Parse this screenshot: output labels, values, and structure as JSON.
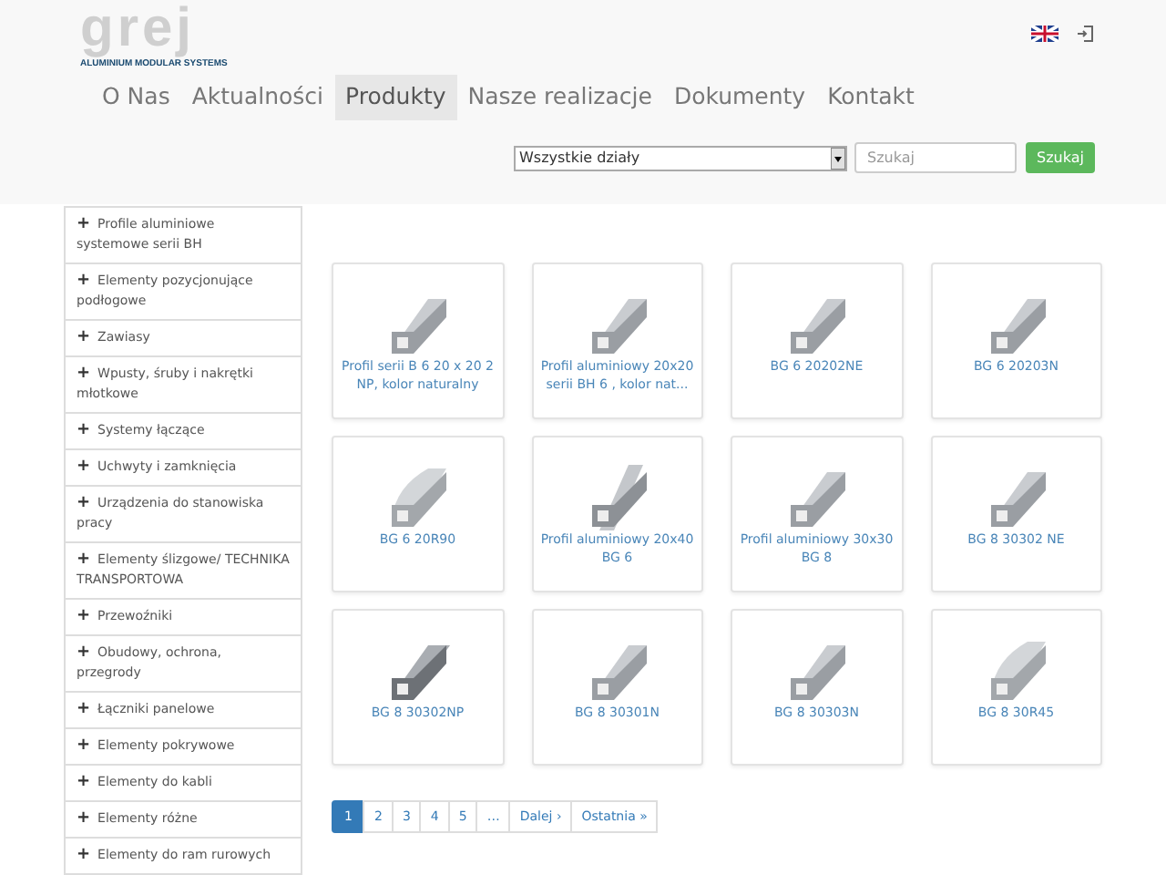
{
  "logo": {
    "name": "grej",
    "tagline": "ALUMINIUM MODULAR SYSTEMS"
  },
  "nav": [
    {
      "label": "O Nas",
      "selected": false
    },
    {
      "label": "Aktualności",
      "selected": false
    },
    {
      "label": "Produkty",
      "selected": true
    },
    {
      "label": "Nasze realizacje",
      "selected": false
    },
    {
      "label": "Dokumenty",
      "selected": false
    },
    {
      "label": "Kontakt",
      "selected": false
    }
  ],
  "search": {
    "department": "Wszystkie działy",
    "placeholder": "Szukaj",
    "button": "Szukaj"
  },
  "sidebar": {
    "icon": "+",
    "items": [
      "Profile aluminiowe systemowe serii BH",
      "Elementy pozycjonujące podłogowe",
      "Zawiasy",
      "Wpusty, śruby i nakrętki młotkowe",
      "Systemy łączące",
      "Uchwyty i zamknięcia",
      "Urządzenia do stanowiska pracy",
      "Elementy ślizgowe/ TECHNIKA TRANSPORTOWA",
      "Przewoźniki",
      "Obudowy, ochrona, przegrody",
      "Łączniki panelowe",
      "Elementy pokrywowe",
      "Elementy do kabli",
      "Elementy różne",
      "Elementy do ram rurowych"
    ]
  },
  "products": [
    {
      "name": "Profil serii B 6 20 x 20 2 NP, kolor naturalny",
      "kind": "square"
    },
    {
      "name": "Profil aluminiowy 20x20 serii BH 6 , kolor nat...",
      "kind": "square"
    },
    {
      "name": "BG 6 20202NE",
      "kind": "square"
    },
    {
      "name": "BG 6 20203N",
      "kind": "square"
    },
    {
      "name": "BG 6 20R90",
      "kind": "round"
    },
    {
      "name": "Profil aluminiowy 20x40 BG 6",
      "kind": "tall"
    },
    {
      "name": "Profil aluminiowy 30x30 BG 8",
      "kind": "square"
    },
    {
      "name": "BG 8 30302 NE",
      "kind": "square"
    },
    {
      "name": "BG 8 30302NP",
      "kind": "dark"
    },
    {
      "name": "BG 8 30301N",
      "kind": "square"
    },
    {
      "name": "BG 8 30303N",
      "kind": "square"
    },
    {
      "name": "BG 8 30R45",
      "kind": "round"
    }
  ],
  "pagination": [
    {
      "label": "1",
      "selected": true
    },
    {
      "label": "2",
      "selected": false
    },
    {
      "label": "3",
      "selected": false
    },
    {
      "label": "4",
      "selected": false
    },
    {
      "label": "5",
      "selected": false
    },
    {
      "label": "…",
      "selected": false
    },
    {
      "label": "Dalej ›",
      "selected": false
    },
    {
      "label": "Ostatnia »",
      "selected": false
    }
  ]
}
